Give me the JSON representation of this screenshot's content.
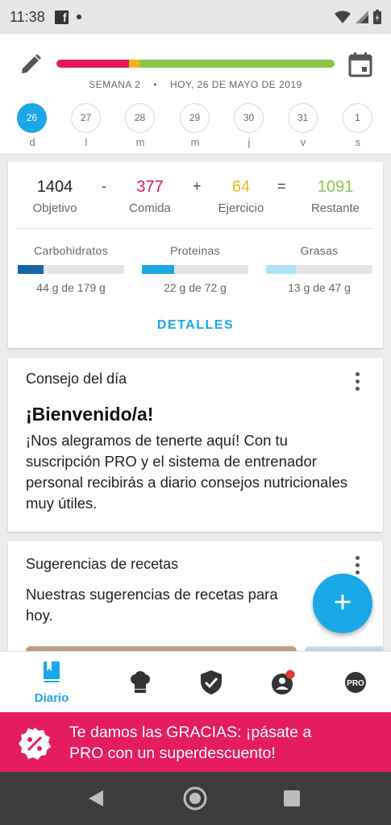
{
  "status_bar": {
    "time": "11:38",
    "facebook_glyph": "f"
  },
  "header": {
    "week_label": "SEMANA 2",
    "separator": "•",
    "date_label": "HOY, 26 DE MAYO DE 2019",
    "progress": {
      "food_fraction": 0.26,
      "exercise_fraction": 0.04,
      "remaining_fraction": 0.7
    },
    "days": [
      {
        "num": "26",
        "letter": "d",
        "active": true
      },
      {
        "num": "27",
        "letter": "l"
      },
      {
        "num": "28",
        "letter": "m"
      },
      {
        "num": "29",
        "letter": "m"
      },
      {
        "num": "30",
        "letter": "j"
      },
      {
        "num": "31",
        "letter": "v"
      },
      {
        "num": "1",
        "letter": "s"
      }
    ]
  },
  "summary": {
    "objetivo": {
      "value": "1404",
      "label": "Objetivo"
    },
    "minus": "-",
    "comida": {
      "value": "377",
      "label": "Comida",
      "color": "#d81b60"
    },
    "plus": "+",
    "ejercicio": {
      "value": "64",
      "label": "Ejercicio",
      "color": "#f2b71c"
    },
    "equals": "=",
    "restante": {
      "value": "1091",
      "label": "Restante",
      "color": "#8cc34a"
    },
    "macros": [
      {
        "name": "Carbohidratos",
        "amount": "44 g de 179 g",
        "fraction": 0.246,
        "color": "#1565a8"
      },
      {
        "name": "Proteinas",
        "amount": "22 g de 72 g",
        "fraction": 0.306,
        "color": "#1ba8e6"
      },
      {
        "name": "Grasas",
        "amount": "13 g de 47 g",
        "fraction": 0.277,
        "color": "#aee0f7"
      }
    ],
    "details_button": "DETALLES"
  },
  "tip_card": {
    "title": "Consejo del día",
    "heading": "¡Bienvenido/a!",
    "body": "¡Nos alegramos de tenerte aquí! Con tu suscripción PRO y el sistema de entrenador personal recibirás a diario consejos nutricionales muy útiles."
  },
  "recipes_card": {
    "title": "Sugerencias de recetas",
    "body": "Nuestras sugerencias de recetas para hoy."
  },
  "fab": {
    "label": "+"
  },
  "bottom_nav": {
    "items": [
      {
        "label": "Diario",
        "icon": "diary-book-icon",
        "active": true
      },
      {
        "label": "",
        "icon": "chef-hat-icon"
      },
      {
        "label": "",
        "icon": "shield-check-icon"
      },
      {
        "label": "",
        "icon": "community-icon",
        "badge": true
      },
      {
        "label": "PRO",
        "icon": "pro-badge-icon"
      }
    ]
  },
  "promo_banner": {
    "text_line1": "Te damos las GRACIAS: ¡pásate a",
    "text_line2": "PRO con un superdescuento!",
    "color": "#e61c63"
  }
}
